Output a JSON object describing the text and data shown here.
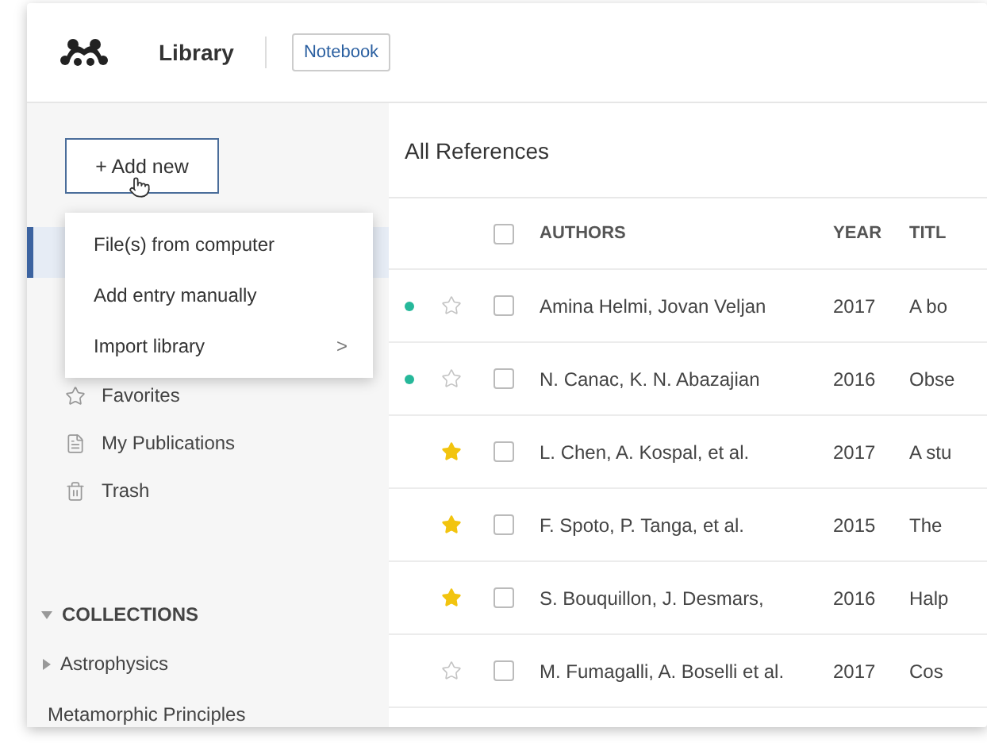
{
  "header": {
    "title": "Library",
    "notebook_button": "Notebook"
  },
  "sidebar": {
    "add_button": "+ Add new",
    "add_menu": [
      {
        "label": "File(s) from computer",
        "kind": "plain"
      },
      {
        "label": "Add entry manually",
        "kind": "plain"
      },
      {
        "label": "Import library",
        "kind": "submenu",
        "arrow": ">"
      }
    ],
    "nav": [
      {
        "label": "Favorites",
        "kind": "star"
      },
      {
        "label": "My Publications",
        "kind": "document"
      },
      {
        "label": "Trash",
        "kind": "trash"
      }
    ],
    "collections": {
      "heading": "COLLECTIONS",
      "expanded": true,
      "items": [
        {
          "label": "Astrophysics",
          "kind": "folder",
          "expanded": false
        },
        {
          "label": "Metamorphic Principles",
          "kind": "leaf"
        }
      ]
    }
  },
  "main": {
    "title": "All References",
    "select_all_checked": false,
    "columns": [
      "AUTHORS",
      "YEAR",
      "TITL"
    ],
    "rows": [
      {
        "unread": true,
        "favorite": false,
        "checked": false,
        "authors": "Amina Helmi, Jovan Veljan",
        "year": "2017",
        "title": "A bo"
      },
      {
        "unread": true,
        "favorite": false,
        "checked": false,
        "authors": "N. Canac, K. N. Abazajian",
        "year": "2016",
        "title": "Obse"
      },
      {
        "unread": false,
        "favorite": true,
        "checked": false,
        "authors": "L. Chen, A. Kospal, et al.",
        "year": "2017",
        "title": "A stu"
      },
      {
        "unread": false,
        "favorite": true,
        "checked": false,
        "authors": "F. Spoto, P. Tanga, et al.",
        "year": "2015",
        "title": "The"
      },
      {
        "unread": false,
        "favorite": true,
        "checked": false,
        "authors": "S. Bouquillon, J. Desmars,",
        "year": "2016",
        "title": "Halp"
      },
      {
        "unread": false,
        "favorite": false,
        "checked": false,
        "authors": "M. Fumagalli, A. Boselli et al.",
        "year": "2017",
        "title": "Cos"
      }
    ]
  }
}
